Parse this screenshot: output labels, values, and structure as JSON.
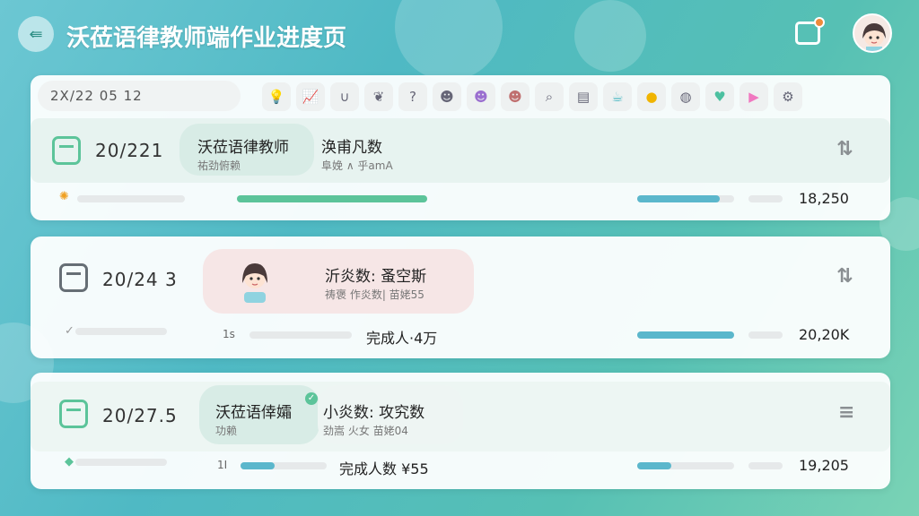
{
  "header": {
    "title": "沃莅语律教师端作业进度页"
  },
  "toolbar": {
    "search_text": "2X/22 05    12",
    "icons": [
      "lightbulb-icon",
      "chart-icon",
      "magnet-icon",
      "leaf-icon",
      "question-icon",
      "student-icon",
      "student-purple-icon",
      "student-girl-icon",
      "search-icon",
      "book-icon",
      "cup-icon",
      "trophy-icon",
      "mouse-icon",
      "heart-icon",
      "play-icon",
      "gear-icon"
    ]
  },
  "rows": [
    {
      "date": "20/221",
      "pill_title": "沃莅语律教师",
      "pill_sub": "祐劲俯赖",
      "stat_title": "涣甫凡数",
      "stat_sub": "阜娩 ∧ 乎amA",
      "bar1_fill": 1.0,
      "bar2_fill": 0.85,
      "total": "18,250"
    },
    {
      "date": "20/24 3",
      "pill_title": "沂炎数:  蚤空斯",
      "pill_sub": "祷褒 作炎数| 苗姥55",
      "prefix": "1s",
      "completed_label": "完成人·4万",
      "bar2_fill": 1.0,
      "total": "20,20K"
    },
    {
      "date": "20/27.5",
      "pill_title": "沃莅语倖孀",
      "pill_sub": "功赖",
      "stat_title": "小炎数:  攻究数",
      "stat_sub": "劲嵩 火女 苗姥04",
      "prefix": "1I",
      "completed_label": "完成人数 ¥55",
      "bar1_fill": 0.4,
      "bar2_fill": 0.35,
      "total": "19,205"
    }
  ],
  "colors": {
    "accent": "#5cc49a",
    "blue_bar": "#5bb7cc",
    "date_icon_gray": "#666e75",
    "pink_pill": "#f6e6e6"
  }
}
